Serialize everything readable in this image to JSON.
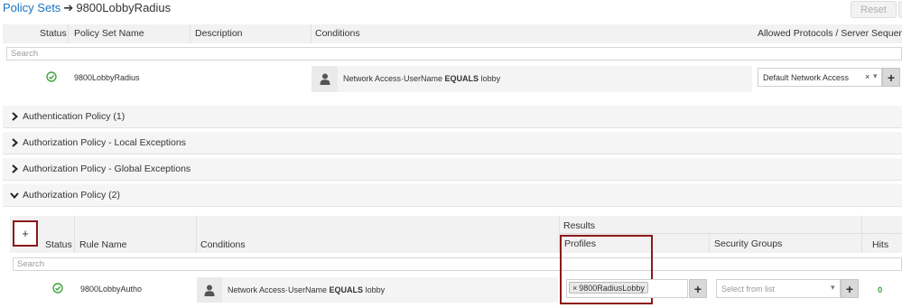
{
  "breadcrumb": {
    "parent": "Policy Sets",
    "arrow": "➔",
    "current": "9800LobbyRadius"
  },
  "toolbar": {
    "reset_label": "Reset"
  },
  "policy_sets_table": {
    "headers": {
      "status": "Status",
      "name": "Policy Set Name",
      "description": "Description",
      "conditions": "Conditions",
      "protocols": "Allowed Protocols / Server Sequence"
    },
    "search_placeholder": "Search",
    "row": {
      "name": "9800LobbyRadius",
      "description": "",
      "condition_attr": "Network Access·UserName",
      "condition_op": "EQUALS",
      "condition_value": "lobby",
      "protocol": "Default Network Access",
      "clear_glyph": "×",
      "dropdown_glyph": "▾",
      "add_glyph": "+"
    }
  },
  "sections": [
    {
      "label": "Authentication Policy (1)",
      "expanded": false
    },
    {
      "label": "Authorization Policy - Local Exceptions",
      "expanded": false
    },
    {
      "label": "Authorization Policy - Global Exceptions",
      "expanded": false
    },
    {
      "label": "Authorization Policy (2)",
      "expanded": true
    }
  ],
  "authz_table": {
    "add_glyph": "+",
    "headers": {
      "status": "Status",
      "rule_name": "Rule Name",
      "conditions": "Conditions",
      "results": "Results",
      "profiles": "Profiles",
      "security_groups": "Security Groups",
      "hits": "Hits"
    },
    "search_placeholder": "Search",
    "row": {
      "rule_name": "9800LobbyAutho",
      "condition_attr": "Network Access·UserName",
      "condition_op": "EQUALS",
      "condition_value": "lobby",
      "profile_tag": "9800RadiusLobby",
      "tag_remove_glyph": "×",
      "profile_add_glyph": "+",
      "security_group_placeholder": "Select from list",
      "sg_dropdown_glyph": "▾",
      "sg_add_glyph": "+",
      "hits": "0"
    }
  },
  "colors": {
    "link": "#1a73c0",
    "status_ok": "#3aa53a",
    "highlight": "#8b1a1a"
  }
}
